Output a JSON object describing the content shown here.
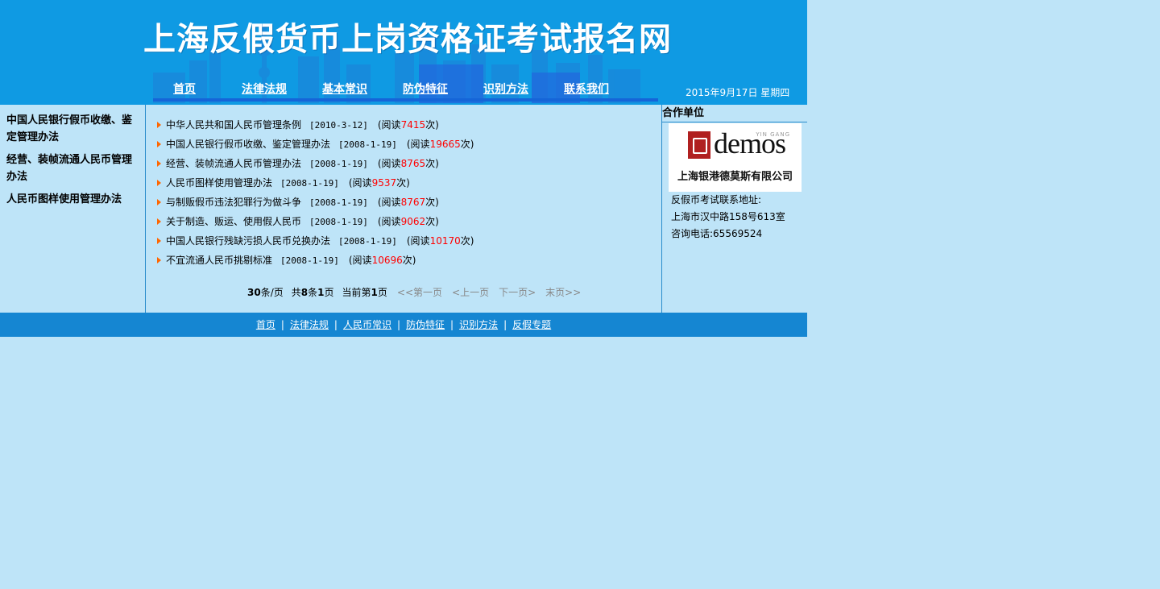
{
  "header": {
    "site_title": "上海反假货币上岗资格证考试报名网",
    "date": "2015年9月17日 星期四",
    "nav": [
      "首页",
      "法律法规",
      "基本常识",
      "防伪特征",
      "识别方法",
      "联系我们"
    ]
  },
  "left_links": [
    "中国人民银行假币收缴、鉴定管理办法",
    "经营、装帧流通人民币管理办法",
    "人民币图样使用管理办法"
  ],
  "articles": [
    {
      "title": "中华人民共和国人民币管理条例",
      "date": "[2010-3-12]",
      "read_prefix": "(阅读",
      "count": "7415",
      "read_suffix": "次)"
    },
    {
      "title": "中国人民银行假币收缴、鉴定管理办法",
      "date": "[2008-1-19]",
      "read_prefix": "(阅读",
      "count": "19665",
      "read_suffix": "次)"
    },
    {
      "title": "经营、装帧流通人民币管理办法",
      "date": "[2008-1-19]",
      "read_prefix": "(阅读",
      "count": "8765",
      "read_suffix": "次)"
    },
    {
      "title": "人民币图样使用管理办法",
      "date": "[2008-1-19]",
      "read_prefix": "(阅读",
      "count": "9537",
      "read_suffix": "次)"
    },
    {
      "title": "与制贩假币违法犯罪行为做斗争",
      "date": "[2008-1-19]",
      "read_prefix": "(阅读",
      "count": "8767",
      "read_suffix": "次)"
    },
    {
      "title": "关于制造、贩运、使用假人民币",
      "date": "[2008-1-19]",
      "read_prefix": "(阅读",
      "count": "9062",
      "read_suffix": "次)"
    },
    {
      "title": "中国人民银行残缺污损人民币兑换办法",
      "date": "[2008-1-19]",
      "read_prefix": "(阅读",
      "count": "10170",
      "read_suffix": "次)"
    },
    {
      "title": "不宜流通人民币挑剔标准",
      "date": "[2008-1-19]",
      "read_prefix": "(阅读",
      "count": "10696",
      "read_suffix": "次)"
    }
  ],
  "pager": {
    "per_page_num": "30",
    "per_page_unit": "条/页",
    "total_pre": "共",
    "total_num": "8",
    "total_unit": "条",
    "pages_num": "1",
    "pages_unit": "页",
    "current_pre": "当前第",
    "current_num": "1",
    "current_unit": "页",
    "first": "<<第一页",
    "prev": "<上一页",
    "next": "下一页>",
    "last": "末页>>"
  },
  "right": {
    "heading": "合作单位",
    "logo_small": "YIN GANG",
    "logo_brand": "demos",
    "logo_cn": "上海银港德莫斯有限公司",
    "contact_label": "反假币考试联系地址:",
    "address": "上海市汉中路158号613室",
    "phone_label": "咨询电话:",
    "phone": "65569524"
  },
  "footer": [
    "首页",
    "法律法规",
    "人民币常识",
    "防伪特征",
    "识别方法",
    "反假专题"
  ],
  "colors": {
    "header_bg": "#0f9ae3",
    "page_bg": "#bee4f8",
    "footer_bg": "#1586d2",
    "count": "#ff0000",
    "bullet": "#ff6600"
  }
}
